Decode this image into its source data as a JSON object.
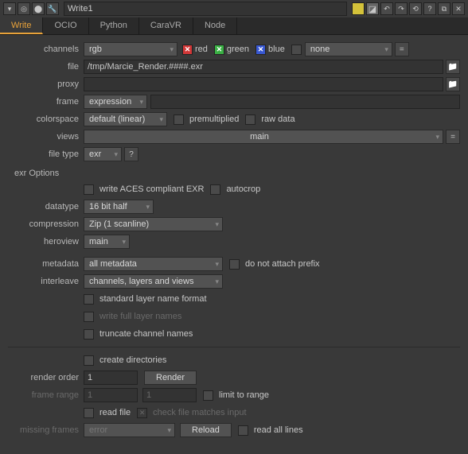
{
  "title": "Write1",
  "tabs": [
    "Write",
    "OCIO",
    "Python",
    "CaraVR",
    "Node"
  ],
  "channels": {
    "label": "channels",
    "value": "rgb",
    "red": "red",
    "green": "green",
    "blue": "blue",
    "none": "none"
  },
  "file": {
    "label": "file",
    "value": "/tmp/Marcie_Render.####.exr"
  },
  "proxy": {
    "label": "proxy",
    "value": ""
  },
  "frame": {
    "label": "frame",
    "mode": "expression",
    "value": ""
  },
  "colorspace": {
    "label": "colorspace",
    "value": "default (linear)",
    "premult": "premultiplied",
    "raw": "raw data"
  },
  "views": {
    "label": "views",
    "value": "main"
  },
  "filetype": {
    "label": "file type",
    "value": "exr",
    "help": "?"
  },
  "exr_options": "exr Options",
  "aces": "write ACES compliant EXR",
  "autocrop": "autocrop",
  "datatype": {
    "label": "datatype",
    "value": "16 bit half"
  },
  "compression": {
    "label": "compression",
    "value": "Zip (1 scanline)"
  },
  "heroview": {
    "label": "heroview",
    "value": "main"
  },
  "metadata": {
    "label": "metadata",
    "value": "all metadata",
    "no_prefix": "do not attach prefix"
  },
  "interleave": {
    "label": "interleave",
    "value": "channels, layers and views"
  },
  "std_layer": "standard layer name format",
  "full_layer": "write full layer names",
  "truncate": "truncate channel names",
  "create_dirs": "create directories",
  "render_order": {
    "label": "render order",
    "value": "1",
    "button": "Render"
  },
  "frame_range": {
    "label": "frame range",
    "start": "1",
    "end": "1",
    "limit": "limit to range"
  },
  "read_file": "read file",
  "check_match": "check file matches input",
  "missing": {
    "label": "missing frames",
    "value": "error",
    "reload": "Reload",
    "read_all": "read all lines"
  }
}
